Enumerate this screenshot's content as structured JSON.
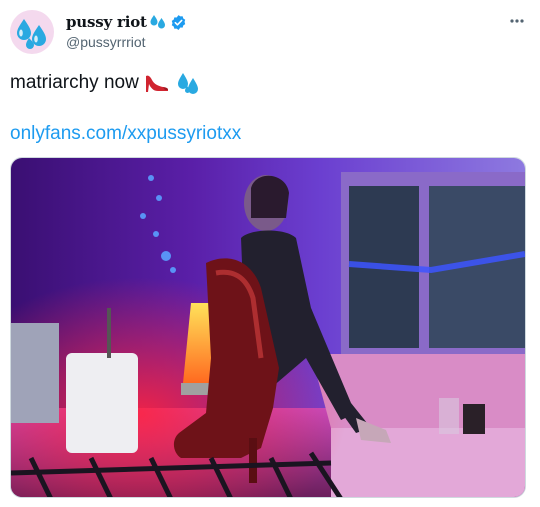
{
  "tweet": {
    "display_name": "pussy riot",
    "handle": "@pussyrrriot",
    "text": "matriarchy now",
    "link": "onlyfans.com/xxpussyriotxx",
    "icons": {
      "name_emoji": "sweat-droplets-icon",
      "verified": "verified-badge-icon",
      "more": "more-icon",
      "text_emoji_1": "high-heel-icon",
      "text_emoji_2": "sweat-droplets-icon"
    },
    "colors": {
      "link": "#1d9bf0",
      "verified": "#1d9bf0",
      "text": "#0f1419",
      "handle": "#536471"
    }
  }
}
